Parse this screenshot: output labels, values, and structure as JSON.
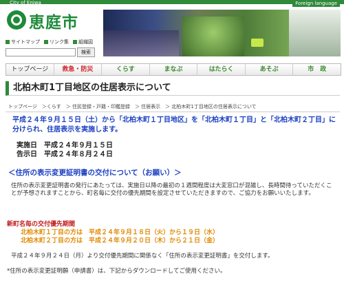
{
  "header": {
    "city_en": "City of Eniwa",
    "foreign_language": "Foreign language",
    "logo_text": "恵庭市",
    "mini_links": [
      "サイトマップ",
      "リンク集",
      "組織図"
    ],
    "search_button": "検索"
  },
  "nav": {
    "items": [
      "トップページ",
      "救急・防災",
      "くらす",
      "まなぶ",
      "はたらく",
      "あそぶ",
      "市　政"
    ]
  },
  "page": {
    "title": "北柏木町1丁目地区の住居表示について",
    "breadcrumb": "トップページ　＞くらす　＞ 住民登録・戸籍・印鑑登録　＞ 住居表示　＞ 北柏木町1丁目地区の住居表示について",
    "lead": "平成２４年９月１５日（土）から「北柏木町１丁目地区」を「北柏木町１丁目」と「北柏木町２丁目」に分けられ、住居表示を実施します。",
    "date_impl": "実施日　平成２４年９月１５日",
    "date_notice": "告示日　平成２４年８月２４日",
    "section_heading": "＜住所の表示変更証明書の交付について（お願い）＞",
    "section_text": "住所の表示変更証明書の発行にあたっては、実施日以降の最初の１週間程度は大変窓口が混雑し、長時間待っていただくことが予想されますことから、町名毎に交付の優先期間を設定させていただきますので、ご協力をお願いいたします。",
    "priority_heading": "新町名毎の交付優先期間",
    "priority_1": "北柏木町１丁目の方は　平成２４年９月１８日（火）から１９日（水）",
    "priority_2": "北柏木町２丁目の方は　平成２４年９月２０日（木）から２１日（金）",
    "note_1": "平成２４年９月２４日（月）より交付優先期間に関係なく「住所の表示変更証明書」を交付します。",
    "note_2": "*住所の表示変更証明願（申請書）は、下記からダウンロードしてご使用ください。"
  }
}
